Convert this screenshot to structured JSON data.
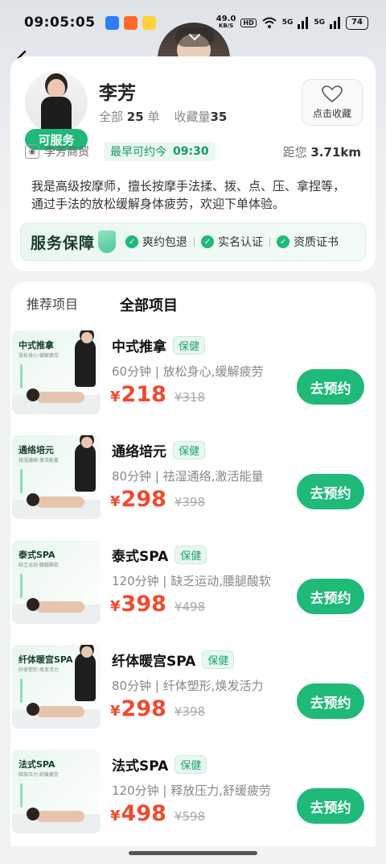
{
  "status_bar": {
    "time": "09:05:05",
    "net_speed": "49.0",
    "net_unit": "KB/S",
    "hd": "HD",
    "signal1": "5G",
    "signal2": "5G",
    "battery": "74"
  },
  "profile": {
    "name": "李芳",
    "badge": "可服务",
    "stats_all_label": "全部",
    "stats_all_value": "25",
    "stats_all_unit": "单",
    "stats_fav_label": "收藏量",
    "stats_fav_value": "35",
    "fav_button_label": "点击收藏",
    "shop_name": "李芳商贸",
    "avail_label": "最早可约今",
    "avail_time": "09:30",
    "distance_label": "距您",
    "distance_value": "3.71km",
    "bio": "我是高级按摩师，擅长按摩手法揉、拨、点、压、拿捏等，通过手法的放松缓解身体疲劳，欢迎下单体验。"
  },
  "guarantee": {
    "title": "服务保障",
    "items": [
      "爽约包退",
      "实名认证",
      "资质证书"
    ]
  },
  "tabs": [
    "推荐项目",
    "全部项目"
  ],
  "services": [
    {
      "thumb_title": "中式推拿",
      "thumb_sub": "放松身心·缓解疲劳",
      "name": "中式推拿",
      "tag": "保健",
      "desc": "60分钟 | 放松身心,缓解疲劳",
      "price": "218",
      "old_price": "¥318",
      "book": "去预约"
    },
    {
      "thumb_title": "通络培元",
      "thumb_sub": "祛湿通络·激活能量",
      "name": "通络培元",
      "tag": "保健",
      "desc": "80分钟 | 祛湿通络,激活能量",
      "price": "298",
      "old_price": "¥398",
      "book": "去预约"
    },
    {
      "thumb_title": "泰式SPA",
      "thumb_sub": "缺乏运动·腰腿酸软",
      "name": "泰式SPA",
      "tag": "保健",
      "desc": "120分钟 | 缺乏运动,腰腿酸软",
      "price": "398",
      "old_price": "¥498",
      "book": "去预约"
    },
    {
      "thumb_title": "纤体暖宫SPA",
      "thumb_sub": "纤体塑形·焕发活力",
      "name": "纤体暖宫SPA",
      "tag": "保健",
      "desc": "80分钟 | 纤体塑形,焕发活力",
      "price": "298",
      "old_price": "¥398",
      "book": "去预约"
    },
    {
      "thumb_title": "法式SPA",
      "thumb_sub": "释放压力·舒缓疲劳",
      "name": "法式SPA",
      "tag": "保健",
      "desc": "120分钟 | 释放压力,舒缓疲劳",
      "price": "498",
      "old_price": "¥598",
      "book": "去预约"
    }
  ],
  "currency": "¥",
  "colors": {
    "accent": "#1fb978",
    "price": "#f04a2f"
  }
}
